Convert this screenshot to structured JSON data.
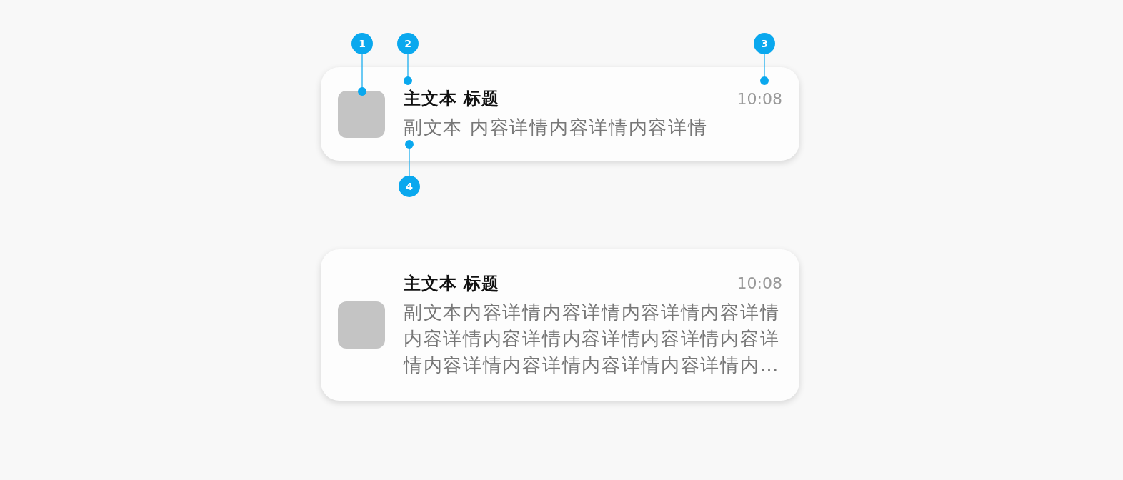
{
  "cards": [
    {
      "title": "主文本 标题",
      "time": "10:08",
      "body": "副文本 内容详情内容详情内容详情"
    },
    {
      "title": "主文本 标题",
      "time": "10:08",
      "body": "副文本内容详情内容详情内容详情内容详情内容详情内容详情内容详情内容详情内容详情内容详情内容详情内容详情内容详情内…"
    }
  ],
  "callouts": [
    {
      "number": "1"
    },
    {
      "number": "2"
    },
    {
      "number": "3"
    },
    {
      "number": "4"
    }
  ]
}
